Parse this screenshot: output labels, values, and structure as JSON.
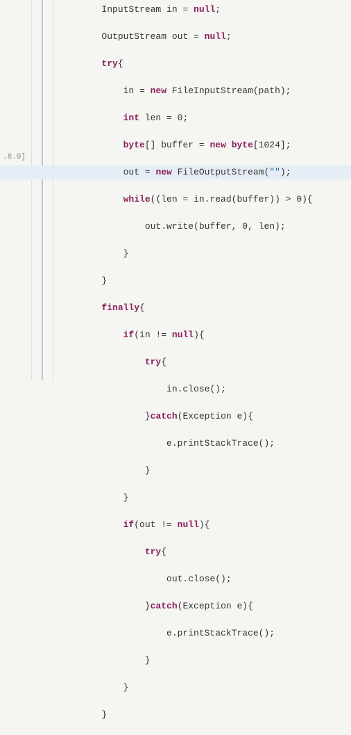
{
  "gutter": {
    "label": ".8.0]"
  },
  "code": {
    "lines": [
      {
        "indent": 2,
        "tokens": [
          [
            "t",
            "InputStream in = "
          ],
          [
            "kw",
            "null"
          ],
          [
            "t",
            ";"
          ]
        ]
      },
      {
        "indent": 2,
        "tokens": [
          [
            "t",
            "OutputStream out = "
          ],
          [
            "kw",
            "null"
          ],
          [
            "t",
            ";"
          ]
        ]
      },
      {
        "indent": 2,
        "tokens": [
          [
            "kw",
            "try"
          ],
          [
            "t",
            "{"
          ]
        ]
      },
      {
        "indent": 3,
        "tokens": [
          [
            "t",
            "in = "
          ],
          [
            "kw",
            "new"
          ],
          [
            "t",
            " FileInputStream(path);"
          ]
        ]
      },
      {
        "indent": 3,
        "tokens": [
          [
            "kw",
            "int"
          ],
          [
            "t",
            " len = 0;"
          ]
        ]
      },
      {
        "indent": 3,
        "tokens": [
          [
            "kw",
            "byte"
          ],
          [
            "t",
            "[] buffer = "
          ],
          [
            "kw",
            "new"
          ],
          [
            "t",
            " "
          ],
          [
            "kw",
            "byte"
          ],
          [
            "t",
            "[1024];"
          ]
        ]
      },
      {
        "indent": 3,
        "highlighted": true,
        "tokens": [
          [
            "t",
            "out = "
          ],
          [
            "kw",
            "new"
          ],
          [
            "t",
            " FileOutputStream("
          ],
          [
            "str",
            "\"\""
          ],
          [
            "t",
            ");"
          ]
        ]
      },
      {
        "indent": 3,
        "tokens": [
          [
            "kw",
            "while"
          ],
          [
            "t",
            "((len = in.read(buffer)) > 0){"
          ]
        ]
      },
      {
        "indent": 4,
        "tokens": [
          [
            "t",
            "out.write(buffer, 0, len);"
          ]
        ]
      },
      {
        "indent": 3,
        "tokens": [
          [
            "t",
            "}"
          ]
        ]
      },
      {
        "indent": 2,
        "tokens": [
          [
            "t",
            "}"
          ]
        ]
      },
      {
        "indent": 2,
        "tokens": [
          [
            "kw",
            "finally"
          ],
          [
            "t",
            "{"
          ]
        ]
      },
      {
        "indent": 3,
        "tokens": [
          [
            "kw",
            "if"
          ],
          [
            "t",
            "(in != "
          ],
          [
            "kw",
            "null"
          ],
          [
            "t",
            "){"
          ]
        ]
      },
      {
        "indent": 4,
        "tokens": [
          [
            "kw",
            "try"
          ],
          [
            "t",
            "{"
          ]
        ]
      },
      {
        "indent": 5,
        "tokens": [
          [
            "t",
            "in.close();"
          ]
        ]
      },
      {
        "indent": 4,
        "tokens": [
          [
            "t",
            "}"
          ],
          [
            "kw",
            "catch"
          ],
          [
            "t",
            "(Exception e){"
          ]
        ]
      },
      {
        "indent": 5,
        "tokens": [
          [
            "t",
            "e.printStackTrace();"
          ]
        ]
      },
      {
        "indent": 4,
        "tokens": [
          [
            "t",
            "}"
          ]
        ]
      },
      {
        "indent": 3,
        "tokens": [
          [
            "t",
            "}"
          ]
        ]
      },
      {
        "indent": 3,
        "tokens": [
          [
            "kw",
            "if"
          ],
          [
            "t",
            "(out != "
          ],
          [
            "kw",
            "null"
          ],
          [
            "t",
            "){"
          ]
        ]
      },
      {
        "indent": 4,
        "tokens": [
          [
            "kw",
            "try"
          ],
          [
            "t",
            "{"
          ]
        ]
      },
      {
        "indent": 5,
        "tokens": [
          [
            "t",
            "out.close();"
          ]
        ]
      },
      {
        "indent": 4,
        "tokens": [
          [
            "t",
            "}"
          ],
          [
            "kw",
            "catch"
          ],
          [
            "t",
            "(Exception e){"
          ]
        ]
      },
      {
        "indent": 5,
        "tokens": [
          [
            "t",
            "e.printStackTrace();"
          ]
        ]
      },
      {
        "indent": 4,
        "tokens": [
          [
            "t",
            "}"
          ]
        ]
      },
      {
        "indent": 3,
        "tokens": [
          [
            "t",
            "}"
          ]
        ]
      },
      {
        "indent": 2,
        "tokens": [
          [
            "t",
            "}"
          ]
        ]
      }
    ]
  }
}
